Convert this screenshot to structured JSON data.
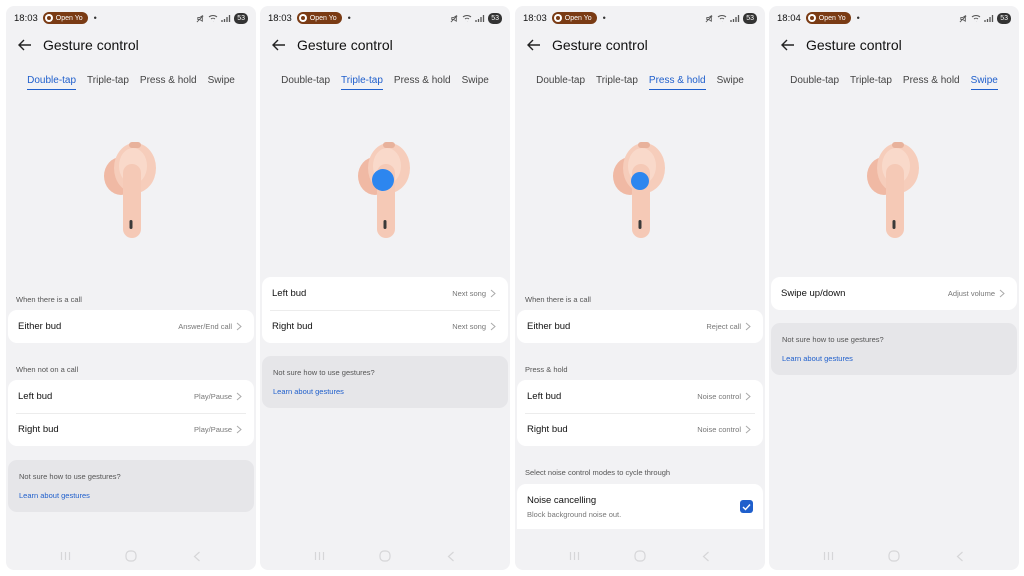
{
  "screens": [
    {
      "status": {
        "time": "18:03",
        "pill": "Open Yo",
        "battery": "53"
      },
      "title": "Gesture control",
      "tabs": [
        "Double-tap",
        "Triple-tap",
        "Press & hold",
        "Swipe"
      ],
      "active_tab": 0,
      "highlight": null,
      "sections": [
        {
          "label": "When there is a call",
          "rows": [
            {
              "label": "Either bud",
              "value": "Answer/End call"
            }
          ]
        },
        {
          "label": "When not on a call",
          "rows": [
            {
              "label": "Left bud",
              "value": "Play/Pause"
            },
            {
              "label": "Right bud",
              "value": "Play/Pause"
            }
          ]
        }
      ],
      "help": {
        "question": "Not sure how to use gestures?",
        "link": "Learn about gestures"
      }
    },
    {
      "status": {
        "time": "18:03",
        "pill": "Open Yo",
        "battery": "53"
      },
      "title": "Gesture control",
      "tabs": [
        "Double-tap",
        "Triple-tap",
        "Press & hold",
        "Swipe"
      ],
      "active_tab": 1,
      "highlight": "center",
      "sections": [
        {
          "label": "",
          "rows": [
            {
              "label": "Left bud",
              "value": "Next song"
            },
            {
              "label": "Right bud",
              "value": "Next song"
            }
          ]
        }
      ],
      "help": {
        "question": "Not sure how to use gestures?",
        "link": "Learn about gestures"
      }
    },
    {
      "status": {
        "time": "18:03",
        "pill": "Open Yo",
        "battery": "53"
      },
      "title": "Gesture control",
      "tabs": [
        "Double-tap",
        "Triple-tap",
        "Press & hold",
        "Swipe"
      ],
      "active_tab": 2,
      "highlight": "stem",
      "sections": [
        {
          "label": "When there is a call",
          "rows": [
            {
              "label": "Either bud",
              "value": "Reject call"
            }
          ]
        },
        {
          "label": "Press & hold",
          "rows": [
            {
              "label": "Left bud",
              "value": "Noise control"
            },
            {
              "label": "Right bud",
              "value": "Noise control"
            }
          ]
        },
        {
          "label": "Select noise control modes to cycle through",
          "check": {
            "label": "Noise cancelling",
            "sub": "Block background noise out.",
            "checked": true
          }
        }
      ]
    },
    {
      "status": {
        "time": "18:04",
        "pill": "Open Yo",
        "battery": "53"
      },
      "title": "Gesture control",
      "tabs": [
        "Double-tap",
        "Triple-tap",
        "Press & hold",
        "Swipe"
      ],
      "active_tab": 3,
      "highlight": null,
      "sections": [
        {
          "label": "",
          "rows": [
            {
              "label": "Swipe up/down",
              "value": "Adjust volume"
            }
          ]
        }
      ],
      "help": {
        "question": "Not sure how to use gestures?",
        "link": "Learn about gestures"
      }
    }
  ],
  "colors": {
    "accent": "#1f5fcc",
    "highlight_dot": "#2d86ef",
    "earbud": "#f4c8b4"
  }
}
